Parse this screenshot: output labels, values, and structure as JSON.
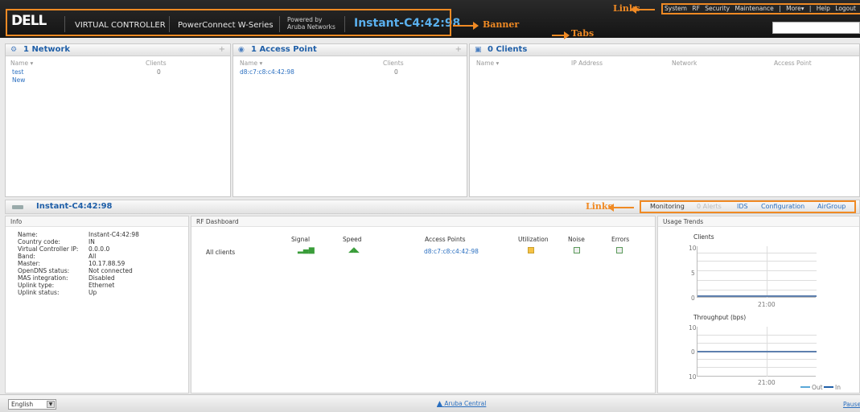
{
  "header": {
    "logo": "DELL",
    "product": "VIRTUAL CONTROLLER",
    "series": "PowerConnect W-Series",
    "powered_by_line1": "Powered by",
    "powered_by_line2": "Aruba Networks",
    "vc_name": "Instant-C4:42:98",
    "search_placeholder": ""
  },
  "top_links": [
    "System",
    "RF",
    "Security",
    "Maintenance",
    "|",
    "More▾",
    "|",
    "Help",
    "Logout"
  ],
  "annotations": {
    "banner": "Banner",
    "links_top": "Links",
    "tabs": "Tabs",
    "links_bottom": "Links"
  },
  "networks": {
    "title": "1 Network",
    "plus": "+",
    "columns": [
      "Name ▾",
      "Clients"
    ],
    "rows": [
      {
        "name": "test",
        "clients": "0"
      },
      {
        "name": "New",
        "clients": ""
      }
    ]
  },
  "access_points": {
    "title": "1 Access Point",
    "plus": "+",
    "columns": [
      "Name ▾",
      "Clients"
    ],
    "rows": [
      {
        "name": "d8:c7:c8:c4:42:98",
        "clients": "0"
      }
    ]
  },
  "clients": {
    "title": "0 Clients",
    "columns": [
      "Name ▾",
      "IP Address",
      "Network",
      "Access Point"
    ]
  },
  "ap_bar": {
    "title": "Instant-C4:42:98",
    "links": [
      "Monitoring",
      "0 Alerts",
      "IDS",
      "Configuration",
      "AirGroup"
    ]
  },
  "info": {
    "heading": "Info",
    "rows": [
      {
        "label": "Name:",
        "value": "Instant-C4:42:98"
      },
      {
        "label": "Country code:",
        "value": "IN"
      },
      {
        "label": "Virtual Controller IP:",
        "value": "0.0.0.0"
      },
      {
        "label": "Band:",
        "value": "All"
      },
      {
        "label": "Master:",
        "value": "10.17.88.59"
      },
      {
        "label": "OpenDNS status:",
        "value": "Not connected"
      },
      {
        "label": "MAS integration:",
        "value": "Disabled"
      },
      {
        "label": "Uplink type:",
        "value": "Ethernet"
      },
      {
        "label": "Uplink status:",
        "value": "Up"
      }
    ]
  },
  "rf_dashboard": {
    "heading": "RF Dashboard",
    "columns": [
      "Signal",
      "Speed",
      "Access Points",
      "Utilization",
      "Noise",
      "Errors"
    ],
    "row_label": "All clients",
    "ap": "d8:c7:c8:c4:42:98"
  },
  "usage_trends": {
    "heading": "Usage Trends",
    "clients_title": "Clients",
    "clients_ticks": [
      "10",
      "5",
      "0"
    ],
    "clients_time": "21:00",
    "throughput_title": "Throughput  (bps)",
    "throughput_ticks": [
      "10",
      "0",
      "10"
    ],
    "throughput_time": "21:00",
    "legend_out": "Out",
    "legend_in": "In"
  },
  "footer": {
    "language": "English",
    "aruba_central": "Aruba Central",
    "pause": "Pause"
  },
  "colors": {
    "accent": "#2a6fc0",
    "annotation": "#f08a24",
    "vc_name": "#5ab0ee"
  }
}
